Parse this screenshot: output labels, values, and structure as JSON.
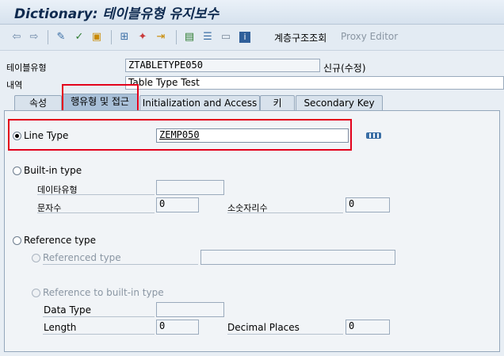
{
  "title": "Dictionary: 테이블유형 유지보수",
  "toolbar": {
    "hierarchy_label": "계층구조조회",
    "proxy_label": "Proxy Editor"
  },
  "header": {
    "type_label": "테이블유형",
    "type_value": "ZTABLETYPE050",
    "status": "신규(수정)",
    "desc_label": "내역",
    "desc_value": "Table Type Test"
  },
  "tabs": [
    {
      "label": "속성"
    },
    {
      "label": "행유형 및 접근"
    },
    {
      "label": "Initialization and Access"
    },
    {
      "label": "키"
    },
    {
      "label": "Secondary Key"
    }
  ],
  "line_type": {
    "label": "Line Type",
    "value": "ZEMP050",
    "selected": true
  },
  "builtin": {
    "label": "Built-in type",
    "data_type_label": "데이타유형",
    "data_type_value": "",
    "chars_label": "문자수",
    "chars_value": "0",
    "decimals_label": "소숫자리수",
    "decimals_value": "0"
  },
  "reference": {
    "label": "Reference type",
    "referenced_label": "Referenced type",
    "referenced_value": "",
    "builtin_ref_label": "Reference to built-in type",
    "data_type_label": "Data Type",
    "data_type_value": "",
    "length_label": "Length",
    "length_value": "0",
    "decimal_label": "Decimal Places",
    "decimal_value": "0"
  }
}
